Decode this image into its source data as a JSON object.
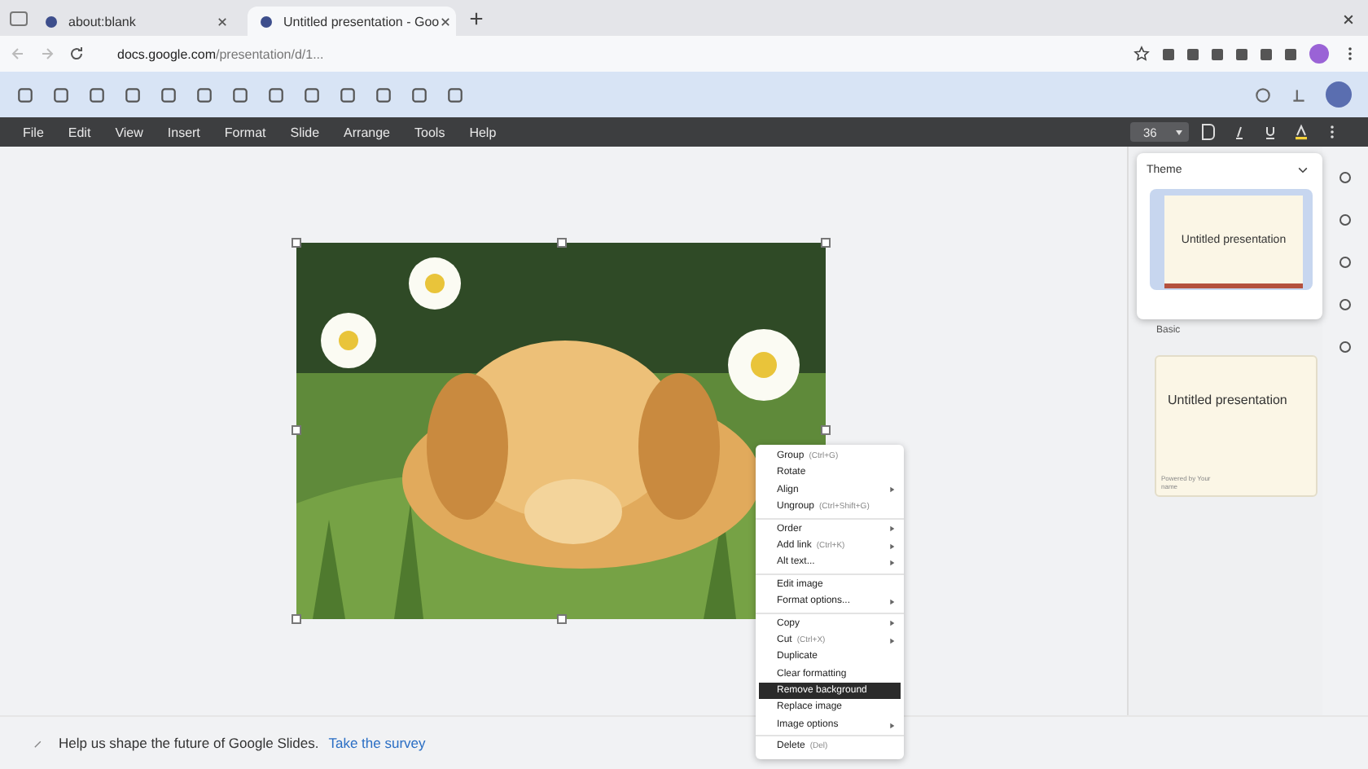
{
  "browser": {
    "tabs": [
      {
        "title": "about:blank",
        "selected": false
      },
      {
        "title": "Untitled presentation - Goo",
        "selected": true
      }
    ],
    "url_host": "docs.google.com",
    "url_path": "/presentation/d/1..."
  },
  "menu_bar": [
    "File",
    "Edit",
    "View",
    "Insert",
    "Format",
    "Slide",
    "Arrange",
    "Tools",
    "Help"
  ],
  "format_toolbar": {
    "font_size": "36"
  },
  "slide": {
    "image": {
      "kind": "picture",
      "selected": true
    }
  },
  "context_menu": {
    "groups": [
      [
        {
          "label": "Group",
          "shortcut": "(Ctrl+G)",
          "submenu": false,
          "selected": false
        },
        {
          "label": "Rotate",
          "submenu": false,
          "selected": false
        },
        {
          "label": "Align",
          "submenu": true,
          "selected": false
        },
        {
          "label": "Ungroup",
          "shortcut": "(Ctrl+Shift+G)",
          "submenu": false,
          "selected": false
        }
      ],
      [
        {
          "label": "Order",
          "submenu": true,
          "selected": false
        },
        {
          "label": "Add link",
          "shortcut": "(Ctrl+K)",
          "submenu": true,
          "selected": false
        },
        {
          "label": "Alt text...",
          "submenu": true,
          "selected": false
        }
      ],
      [
        {
          "label": "Edit image",
          "submenu": false,
          "selected": false
        },
        {
          "label": "Format options...",
          "submenu": true,
          "selected": false
        }
      ],
      [
        {
          "label": "Copy",
          "submenu": true,
          "selected": false
        },
        {
          "label": "Cut",
          "shortcut": "(Ctrl+X)",
          "submenu": true,
          "selected": false
        },
        {
          "label": "Duplicate",
          "submenu": false,
          "selected": false
        },
        {
          "label": "Clear formatting",
          "submenu": false,
          "selected": false
        },
        {
          "label": "Remove background",
          "submenu": false,
          "selected": true
        },
        {
          "label": "Replace image",
          "submenu": false,
          "selected": false
        },
        {
          "label": "Image options",
          "submenu": true,
          "selected": false
        }
      ],
      [
        {
          "label": "Delete",
          "shortcut": "(Del)",
          "submenu": false,
          "selected": false
        }
      ]
    ]
  },
  "theme_popup": {
    "title": "Theme",
    "card_title": "Untitled presentation"
  },
  "themes_panel": {
    "section": "Basic",
    "card_title": "Untitled presentation",
    "card_footer": "Powered by Your name"
  },
  "footer": {
    "message": "Help us shape the future of Google Slides.",
    "link": "Take the survey"
  }
}
